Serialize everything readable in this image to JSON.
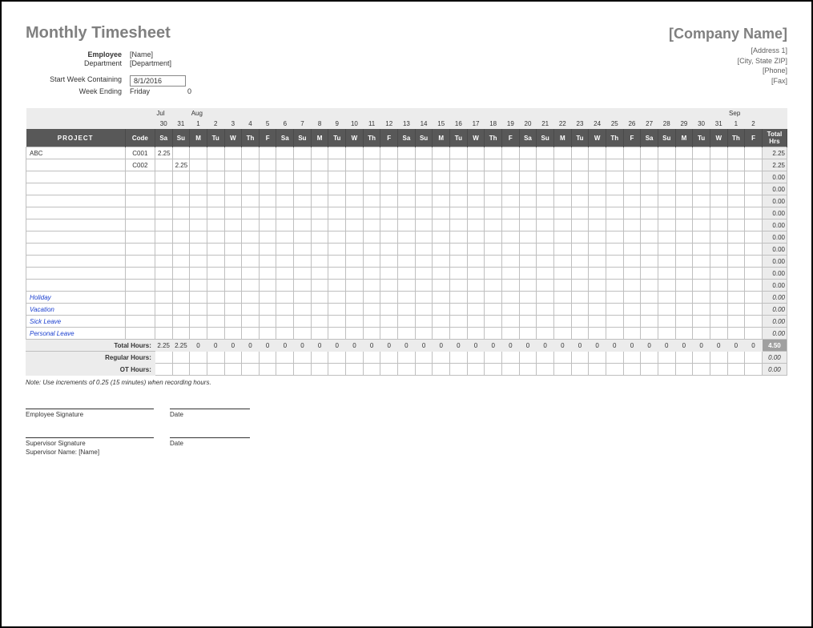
{
  "header": {
    "title": "Monthly Timesheet",
    "company_name": "[Company Name]",
    "addr1": "[Address 1]",
    "addr2": "[City, State ZIP]",
    "phone": "[Phone]",
    "fax": "[Fax]"
  },
  "meta": {
    "employee_label": "Employee",
    "employee_value": "[Name]",
    "department_label": "Department",
    "department_value": "[Department]",
    "start_week_label": "Start Week Containing",
    "start_week_value": "8/1/2016",
    "week_ending_label": "Week Ending",
    "week_ending_value": "Friday",
    "week_ending_extra": "0"
  },
  "months": [
    {
      "at": 0,
      "label": "Jul"
    },
    {
      "at": 2,
      "label": "Aug"
    },
    {
      "at": 33,
      "label": "Sep"
    }
  ],
  "dates": [
    "30",
    "31",
    "1",
    "2",
    "3",
    "4",
    "5",
    "6",
    "7",
    "8",
    "9",
    "10",
    "11",
    "12",
    "13",
    "14",
    "15",
    "16",
    "17",
    "18",
    "19",
    "20",
    "21",
    "22",
    "23",
    "24",
    "25",
    "26",
    "27",
    "28",
    "29",
    "30",
    "31",
    "1",
    "2"
  ],
  "weekdays": [
    "Sa",
    "Su",
    "M",
    "Tu",
    "W",
    "Th",
    "F",
    "Sa",
    "Su",
    "M",
    "Tu",
    "W",
    "Th",
    "F",
    "Sa",
    "Su",
    "M",
    "Tu",
    "W",
    "Th",
    "F",
    "Sa",
    "Su",
    "M",
    "Tu",
    "W",
    "Th",
    "F",
    "Sa",
    "Su",
    "M",
    "Tu",
    "W",
    "Th",
    "F"
  ],
  "col_project": "PROJECT",
  "col_code": "Code",
  "col_total": "Total Hrs",
  "rows": [
    {
      "project": "ABC",
      "code": "C001",
      "cells": [
        "2.25",
        "",
        "",
        "",
        "",
        "",
        "",
        "",
        "",
        "",
        "",
        "",
        "",
        "",
        "",
        "",
        "",
        "",
        "",
        "",
        "",
        "",
        "",
        "",
        "",
        "",
        "",
        "",
        "",
        "",
        "",
        "",
        "",
        "",
        ""
      ],
      "total": "2.25"
    },
    {
      "project": "",
      "code": "C002",
      "cells": [
        "",
        "2.25",
        "",
        "",
        "",
        "",
        "",
        "",
        "",
        "",
        "",
        "",
        "",
        "",
        "",
        "",
        "",
        "",
        "",
        "",
        "",
        "",
        "",
        "",
        "",
        "",
        "",
        "",
        "",
        "",
        "",
        "",
        "",
        "",
        ""
      ],
      "total": "2.25"
    },
    {
      "project": "",
      "code": "",
      "cells": [
        "",
        "",
        "",
        "",
        "",
        "",
        "",
        "",
        "",
        "",
        "",
        "",
        "",
        "",
        "",
        "",
        "",
        "",
        "",
        "",
        "",
        "",
        "",
        "",
        "",
        "",
        "",
        "",
        "",
        "",
        "",
        "",
        "",
        "",
        ""
      ],
      "total": "0.00"
    },
    {
      "project": "",
      "code": "",
      "cells": [
        "",
        "",
        "",
        "",
        "",
        "",
        "",
        "",
        "",
        "",
        "",
        "",
        "",
        "",
        "",
        "",
        "",
        "",
        "",
        "",
        "",
        "",
        "",
        "",
        "",
        "",
        "",
        "",
        "",
        "",
        "",
        "",
        "",
        "",
        ""
      ],
      "total": "0.00"
    },
    {
      "project": "",
      "code": "",
      "cells": [
        "",
        "",
        "",
        "",
        "",
        "",
        "",
        "",
        "",
        "",
        "",
        "",
        "",
        "",
        "",
        "",
        "",
        "",
        "",
        "",
        "",
        "",
        "",
        "",
        "",
        "",
        "",
        "",
        "",
        "",
        "",
        "",
        "",
        "",
        ""
      ],
      "total": "0.00"
    },
    {
      "project": "",
      "code": "",
      "cells": [
        "",
        "",
        "",
        "",
        "",
        "",
        "",
        "",
        "",
        "",
        "",
        "",
        "",
        "",
        "",
        "",
        "",
        "",
        "",
        "",
        "",
        "",
        "",
        "",
        "",
        "",
        "",
        "",
        "",
        "",
        "",
        "",
        "",
        "",
        ""
      ],
      "total": "0.00"
    },
    {
      "project": "",
      "code": "",
      "cells": [
        "",
        "",
        "",
        "",
        "",
        "",
        "",
        "",
        "",
        "",
        "",
        "",
        "",
        "",
        "",
        "",
        "",
        "",
        "",
        "",
        "",
        "",
        "",
        "",
        "",
        "",
        "",
        "",
        "",
        "",
        "",
        "",
        "",
        "",
        ""
      ],
      "total": "0.00"
    },
    {
      "project": "",
      "code": "",
      "cells": [
        "",
        "",
        "",
        "",
        "",
        "",
        "",
        "",
        "",
        "",
        "",
        "",
        "",
        "",
        "",
        "",
        "",
        "",
        "",
        "",
        "",
        "",
        "",
        "",
        "",
        "",
        "",
        "",
        "",
        "",
        "",
        "",
        "",
        "",
        ""
      ],
      "total": "0.00"
    },
    {
      "project": "",
      "code": "",
      "cells": [
        "",
        "",
        "",
        "",
        "",
        "",
        "",
        "",
        "",
        "",
        "",
        "",
        "",
        "",
        "",
        "",
        "",
        "",
        "",
        "",
        "",
        "",
        "",
        "",
        "",
        "",
        "",
        "",
        "",
        "",
        "",
        "",
        "",
        "",
        ""
      ],
      "total": "0.00"
    },
    {
      "project": "",
      "code": "",
      "cells": [
        "",
        "",
        "",
        "",
        "",
        "",
        "",
        "",
        "",
        "",
        "",
        "",
        "",
        "",
        "",
        "",
        "",
        "",
        "",
        "",
        "",
        "",
        "",
        "",
        "",
        "",
        "",
        "",
        "",
        "",
        "",
        "",
        "",
        "",
        ""
      ],
      "total": "0.00"
    },
    {
      "project": "",
      "code": "",
      "cells": [
        "",
        "",
        "",
        "",
        "",
        "",
        "",
        "",
        "",
        "",
        "",
        "",
        "",
        "",
        "",
        "",
        "",
        "",
        "",
        "",
        "",
        "",
        "",
        "",
        "",
        "",
        "",
        "",
        "",
        "",
        "",
        "",
        "",
        "",
        ""
      ],
      "total": "0.00"
    },
    {
      "project": "",
      "code": "",
      "cells": [
        "",
        "",
        "",
        "",
        "",
        "",
        "",
        "",
        "",
        "",
        "",
        "",
        "",
        "",
        "",
        "",
        "",
        "",
        "",
        "",
        "",
        "",
        "",
        "",
        "",
        "",
        "",
        "",
        "",
        "",
        "",
        "",
        "",
        "",
        ""
      ],
      "total": "0.00"
    }
  ],
  "leave_rows": [
    {
      "project": "Holiday",
      "total": "0.00"
    },
    {
      "project": "Vacation",
      "total": "0.00"
    },
    {
      "project": "Sick Leave",
      "total": "0.00"
    },
    {
      "project": "Personal Leave",
      "total": "0.00"
    }
  ],
  "totals": {
    "total_hours_label": "Total Hours:",
    "total_hours": [
      "2.25",
      "2.25",
      "0",
      "0",
      "0",
      "0",
      "0",
      "0",
      "0",
      "0",
      "0",
      "0",
      "0",
      "0",
      "0",
      "0",
      "0",
      "0",
      "0",
      "0",
      "0",
      "0",
      "0",
      "0",
      "0",
      "0",
      "0",
      "0",
      "0",
      "0",
      "0",
      "0",
      "0",
      "0",
      "0"
    ],
    "grand_total": "4.50",
    "regular_label": "Regular Hours:",
    "regular_total": "0.00",
    "ot_label": "OT Hours:",
    "ot_total": "0.00"
  },
  "note": "Note: Use increments of 0.25 (15 minutes) when recording hours.",
  "sign": {
    "emp_sig": "Employee Signature",
    "date": "Date",
    "sup_sig": "Supervisor Signature",
    "sup_name_label": "Supervisor Name:",
    "sup_name_value": "[Name]"
  }
}
